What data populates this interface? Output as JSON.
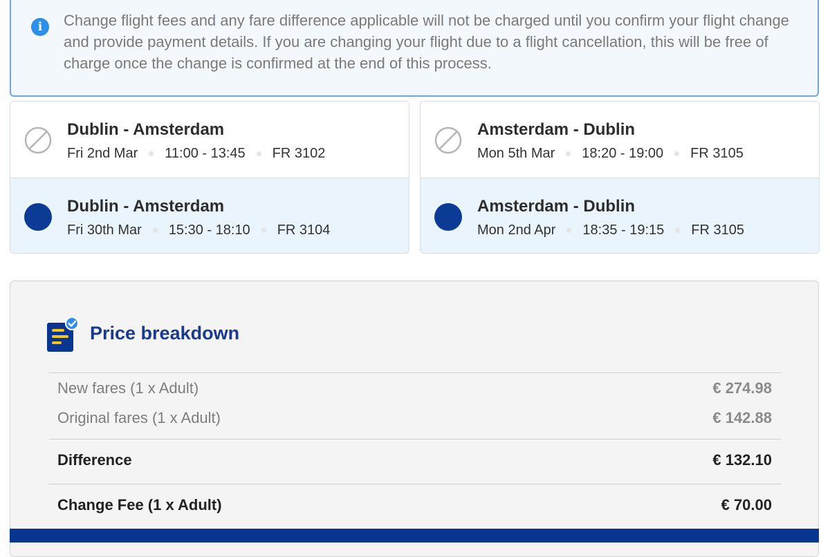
{
  "info": {
    "text": "Change flight fees and any fare difference applicable will not be charged until you confirm your flight change and provide payment details. If you are changing your flight due to a flight cancellation, this will be free of charge once the change is confirmed at the end of this process."
  },
  "flights": {
    "outbound": {
      "old": {
        "route": "Dublin - Amsterdam",
        "date": "Fri 2nd Mar",
        "time": "11:00 - 13:45",
        "flight": "FR 3102"
      },
      "new": {
        "route": "Dublin - Amsterdam",
        "date": "Fri 30th Mar",
        "time": "15:30 - 18:10",
        "flight": "FR 3104"
      }
    },
    "inbound": {
      "old": {
        "route": "Amsterdam - Dublin",
        "date": "Mon 5th Mar",
        "time": "18:20 - 19:00",
        "flight": "FR 3105"
      },
      "new": {
        "route": "Amsterdam - Dublin",
        "date": "Mon 2nd Apr",
        "time": "18:35 - 19:15",
        "flight": "FR 3105"
      }
    }
  },
  "price": {
    "title": "Price breakdown",
    "new_fares": {
      "label": "New fares (1 x Adult)",
      "amount": "€ 274.98"
    },
    "original_fares": {
      "label": "Original fares (1 x Adult)",
      "amount": "€ 142.88"
    },
    "difference": {
      "label": "Difference",
      "amount": "€ 132.10"
    },
    "change_fee": {
      "label": "Change Fee (1 x Adult)",
      "amount": "€ 70.00"
    }
  },
  "colors": {
    "brand_blue": "#073590",
    "selected_dot": "#0c3b96",
    "info_border": "#6fa6dd",
    "info_icon": "#2f8fe8"
  }
}
